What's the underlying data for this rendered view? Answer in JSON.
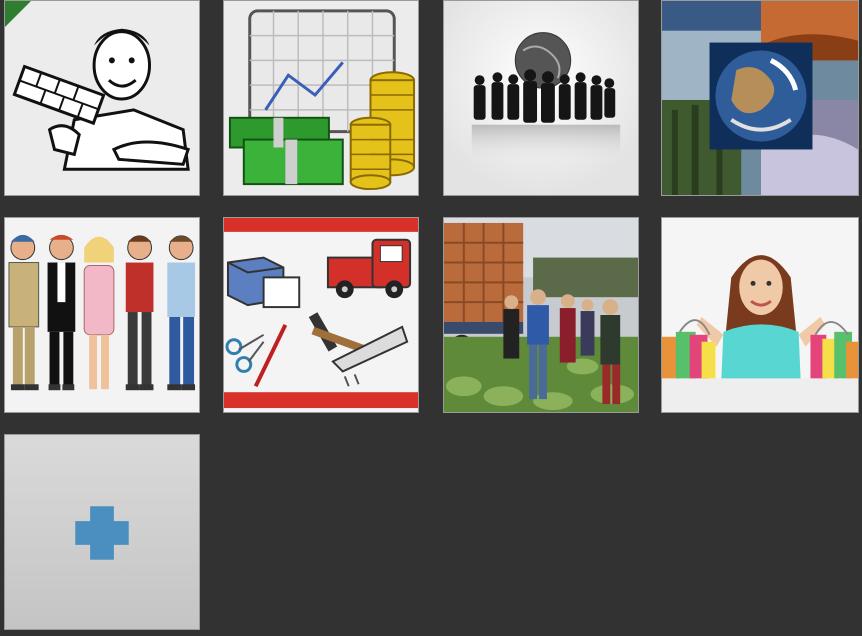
{
  "tiles": [
    {
      "icon": "salesman-with-bricks-icon"
    },
    {
      "icon": "chart-with-money-icon"
    },
    {
      "icon": "business-people-globe-icon"
    },
    {
      "icon": "earth-collage-icon"
    },
    {
      "icon": "workers-group-icon"
    },
    {
      "icon": "tools-supplies-icon"
    },
    {
      "icon": "farm-crowd-truck-icon"
    },
    {
      "icon": "shopping-woman-icon"
    }
  ],
  "add_tile": {
    "icon": "plus-icon"
  },
  "colors": {
    "background": "#323232",
    "tile": "#e6e6e6",
    "accent_green": "#2f7d2f",
    "plus_blue": "#4a8fc0"
  }
}
